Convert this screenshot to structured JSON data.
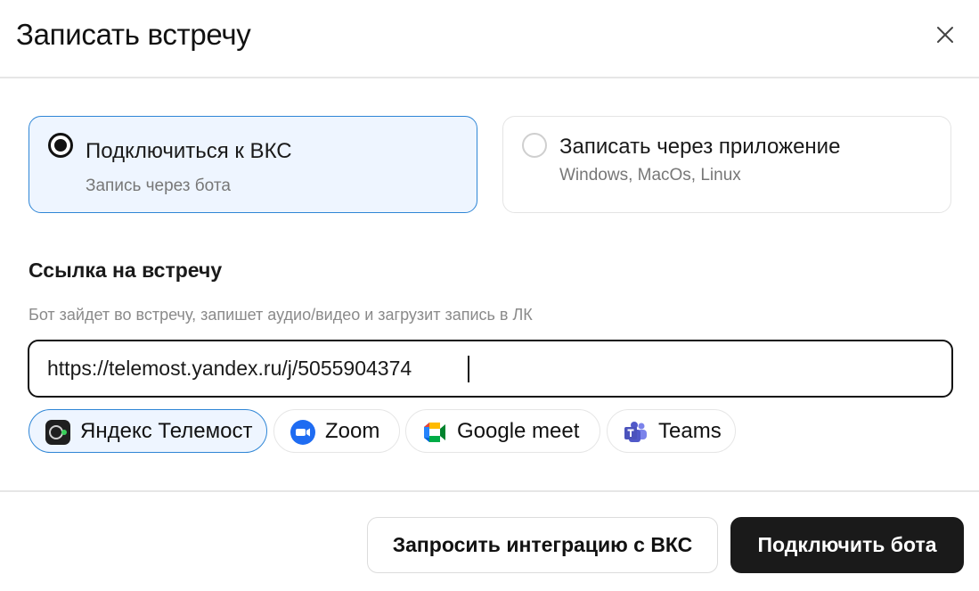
{
  "dialog": {
    "title": "Записать встречу",
    "close_icon": "close-icon"
  },
  "options": [
    {
      "label": "Подключиться к ВКС",
      "sub": "Запись через бота",
      "selected": true
    },
    {
      "label": "Записать через приложение",
      "sub": "Windows, MacOs, Linux",
      "selected": false
    }
  ],
  "link_section": {
    "title": "Ссылка на встречу",
    "hint": "Бот зайдет во встречу, запишет аудио/видео и загрузит запись в ЛК",
    "input_value": "https://telemost.yandex.ru/j/5055904374"
  },
  "platforms": [
    {
      "label": "Яндекс Телемост",
      "icon": "yandex-telemost-icon",
      "selected": true
    },
    {
      "label": "Zoom",
      "icon": "zoom-icon",
      "selected": false
    },
    {
      "label": "Google meet",
      "icon": "google-meet-icon",
      "selected": false
    },
    {
      "label": "Teams",
      "icon": "teams-icon",
      "selected": false
    }
  ],
  "footer": {
    "secondary_label": "Запросить интеграцию с ВКС",
    "primary_label": "Подключить бота"
  },
  "colors": {
    "accent": "#2f86d6",
    "selected_bg": "#eef5ff",
    "primary_button": "#1a1a1a"
  }
}
